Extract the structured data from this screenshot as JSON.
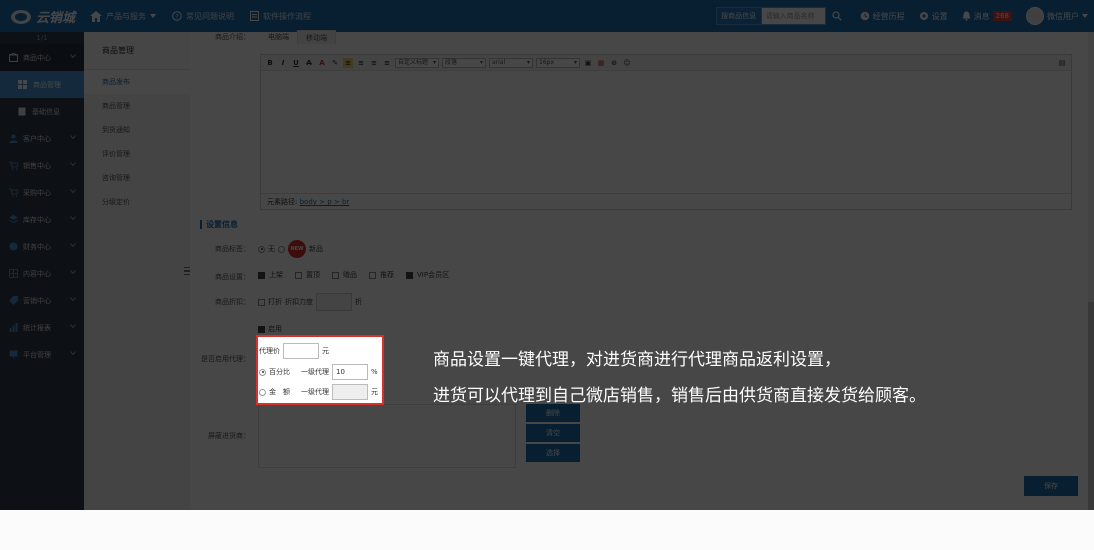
{
  "app": {
    "logo_text": "云销城"
  },
  "topnav": {
    "items": [
      {
        "label": "产品与服务",
        "icon": "home-icon"
      },
      {
        "label": "常见问题说明",
        "icon": "help-circle-icon"
      },
      {
        "label": "软件操作流程",
        "icon": "document-icon"
      }
    ]
  },
  "topright": {
    "search_select": "搜商品信息",
    "search_placeholder": "请输入商品名称",
    "history_label": "经营历程",
    "settings_label": "设置",
    "messages_label": "消息",
    "messages_count": "268",
    "user_label": "微信用户"
  },
  "sidebar": {
    "top_label": "1/1",
    "items": [
      {
        "label": "商品中心",
        "icon": "box-icon",
        "active": true
      },
      {
        "label": "商品管理",
        "sub": true,
        "active": true
      },
      {
        "label": "基础信息",
        "sub": true
      },
      {
        "label": "客户中心",
        "icon": "user-icon"
      },
      {
        "label": "销售中心",
        "icon": "cart-icon"
      },
      {
        "label": "采购中心",
        "icon": "cart-icon"
      },
      {
        "label": "库存中心",
        "icon": "stack-icon"
      },
      {
        "label": "财务中心",
        "icon": "coin-icon"
      },
      {
        "label": "内容中心",
        "icon": "grid-icon"
      },
      {
        "label": "营销中心",
        "icon": "tag-icon"
      },
      {
        "label": "统计报表",
        "icon": "chart-icon"
      },
      {
        "label": "平台管理",
        "icon": "monitor-icon"
      }
    ]
  },
  "submenu": {
    "title": "商品管理",
    "items": [
      "商品发布",
      "商品管理",
      "到货通知",
      "评价管理",
      "咨询管理",
      "分级定价"
    ]
  },
  "form": {
    "desc_label": "商品介绍：",
    "tabs": [
      "电脑端",
      "移动端"
    ],
    "editor": {
      "font_select": "自定义标题",
      "para_select": "段落",
      "family_select": "arial",
      "size_select": "16px",
      "path_label": "元素路径:",
      "path_links": "body > p > br"
    },
    "section_title": "设置信息",
    "tag_label": "商品标签：",
    "tag_none": "无",
    "tag_new_badge": "NEW",
    "tag_new": "新品",
    "settings_label": "商品设置：",
    "settings_options": [
      "上架",
      "置顶",
      "赠品",
      "推荐",
      "VIP会员区"
    ],
    "discount_label": "商品折扣：",
    "discount_text": "打折",
    "discount_rate": "折扣力度",
    "discount_unit": "折",
    "agent_enable": "启用",
    "agent_label": "是否启用代理：",
    "agent_price_label": "代理价",
    "agent_price_unit": "元",
    "agent_percent": "百分比",
    "agent_level1": "一级代理",
    "agent_percent_value": "10",
    "agent_percent_unit": "%",
    "agent_amount": "金　额",
    "agent_amount_level1": "一级代理",
    "agent_amount_unit": "元",
    "blocked_label": "屏蔽进货商：",
    "btn_delete": "删除",
    "btn_clear": "清空",
    "btn_choose": "选择",
    "btn_save": "保存"
  },
  "caption": {
    "line1": "商品设置一键代理，对进货商进行代理商品返利设置，",
    "line2": "进货可以代理到自己微店销售，销售后由供货商直接发货给顾客。"
  },
  "colors": {
    "brand": "#1f6fb5",
    "sidebar": "#2f3a4a",
    "highlight_border": "#d9312a"
  }
}
